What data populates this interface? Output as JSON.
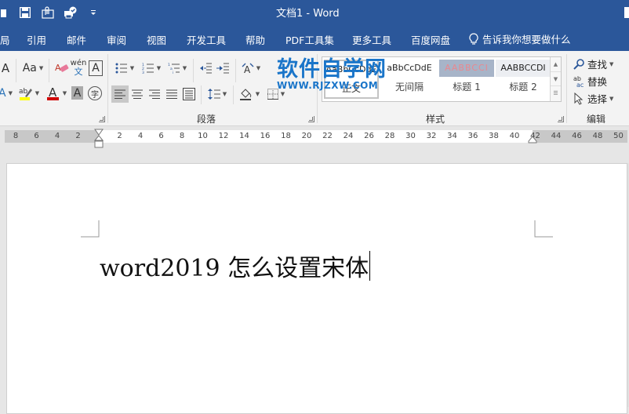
{
  "window": {
    "title": "文档1  -  Word"
  },
  "quick_access": [
    {
      "icon": "open-icon"
    },
    {
      "icon": "save-icon"
    },
    {
      "icon": "attach-icon"
    },
    {
      "icon": "print-check-icon"
    },
    {
      "icon": "customize-qat-icon"
    }
  ],
  "tabs": [
    {
      "label": "局"
    },
    {
      "label": "引用"
    },
    {
      "label": "邮件"
    },
    {
      "label": "审阅"
    },
    {
      "label": "视图"
    },
    {
      "label": "开发工具"
    },
    {
      "label": "帮助"
    },
    {
      "label": "PDF工具集"
    },
    {
      "label": "更多工具"
    },
    {
      "label": "百度网盘"
    }
  ],
  "tell_me": {
    "label": "告诉我你想要做什么"
  },
  "ribbon": {
    "font_group": {
      "change_case_label": "Aa",
      "phonetic_top": "wén",
      "phonetic_bottom": "文",
      "border_char": "A",
      "shading_char": "A",
      "enclose_char": "字",
      "highlight_color": "#ffff00",
      "font_color": "#d00000"
    },
    "paragraph_group": {
      "label": "段落"
    },
    "styles_group": {
      "label": "样式",
      "items": [
        {
          "preview": "AaBbCcDdE",
          "name": "正文"
        },
        {
          "preview": "aBbCcDdE",
          "name": "无间隔"
        },
        {
          "preview": "AABBCCI",
          "name": "标题 1"
        },
        {
          "preview": "AABBCCDI",
          "name": "标题 2"
        }
      ]
    },
    "editing_group": {
      "label": "编辑",
      "find": "查找",
      "replace": "替换",
      "select": "选择"
    }
  },
  "watermark": {
    "title": "软件自学网",
    "url": "WWW.RJZXW.COM"
  },
  "ruler": {
    "left_ticks": [
      "8",
      "6",
      "4",
      "2"
    ],
    "right_ticks": [
      "2",
      "4",
      "6",
      "8",
      "10",
      "12",
      "14",
      "16",
      "18",
      "20",
      "22",
      "24",
      "26",
      "28",
      "30",
      "32",
      "34",
      "36",
      "38",
      "40",
      "42",
      "44",
      "46",
      "48",
      "50"
    ]
  },
  "document": {
    "text": "word2019 怎么设置宋体"
  },
  "colors": {
    "brand": "#2b579a",
    "watermark": "#1a75c9"
  }
}
